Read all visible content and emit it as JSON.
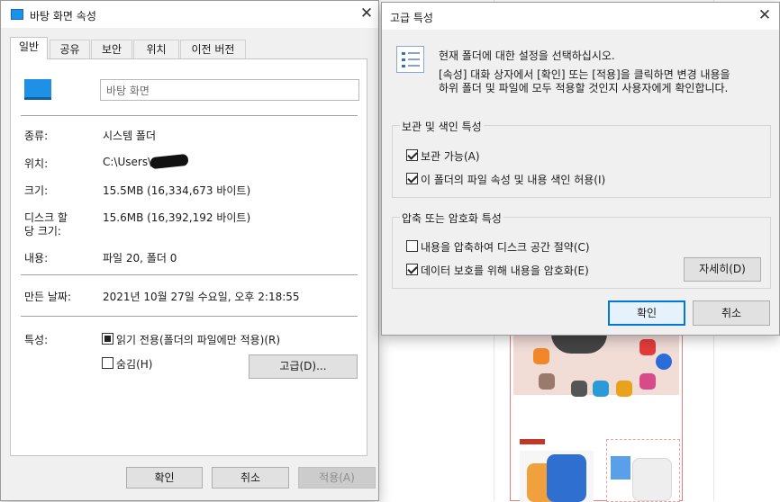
{
  "left_dialog": {
    "title": "바탕 화면 속성",
    "tabs": [
      {
        "label": "일반"
      },
      {
        "label": "공유"
      },
      {
        "label": "보안"
      },
      {
        "label": "위치"
      },
      {
        "label": "이전 버전"
      }
    ],
    "name_value": "바탕 화면",
    "rows": {
      "type_label": "종류:",
      "type_value": "시스템 폴더",
      "location_label": "위치:",
      "location_value": "C:\\Users\\",
      "size_label": "크기:",
      "size_value": "15.5MB (16,334,673 바이트)",
      "disk_size_label_1": "디스크 할",
      "disk_size_label_2": "당 크기:",
      "disk_size_value": "15.6MB (16,392,192 바이트)",
      "contents_label": "내용:",
      "contents_value": "파일 20, 폴더 0",
      "created_label": "만든 날짜:",
      "created_value": "2021년 10월 27일 수요일, 오후 2:18:55",
      "attributes_label": "특성:"
    },
    "readonly_label": "읽기 전용(폴더의 파일에만 적용)(R)",
    "hidden_label": "숨김(H)",
    "advanced_button": "고급(D)...",
    "ok_button": "확인",
    "cancel_button": "취소",
    "apply_button": "적용(A)"
  },
  "right_dialog": {
    "title": "고급 특성",
    "intro_line1": "현재 폴더에 대한 설정을 선택하십시오.",
    "intro_line2": "[속성] 대화 상자에서 [확인] 또는 [적용]을 클릭하면 변경 내용을",
    "intro_line3": "하위 폴더 및 파일에 모두 적용할 것인지 사용자에게 확인합니다.",
    "archive_group_title": "보관 및 색인 특성",
    "archive_label": "보관 가능(A)",
    "index_label": "이 폴더의 파일 속성 및 내용 색인 허용(I)",
    "compress_group_title": "압축 또는 암호화 특성",
    "compress_label": "내용을 압축하여 디스크 공간 절약(C)",
    "encrypt_label": "데이터 보호를 위해 내용을 암호화(E)",
    "details_button": "자세히(D)",
    "ok_button": "확인",
    "cancel_button": "취소"
  },
  "colors": {
    "accent": "#0078d7",
    "dialog_bg": "#f0f0f0",
    "folder_icon": "#1e90e6"
  }
}
